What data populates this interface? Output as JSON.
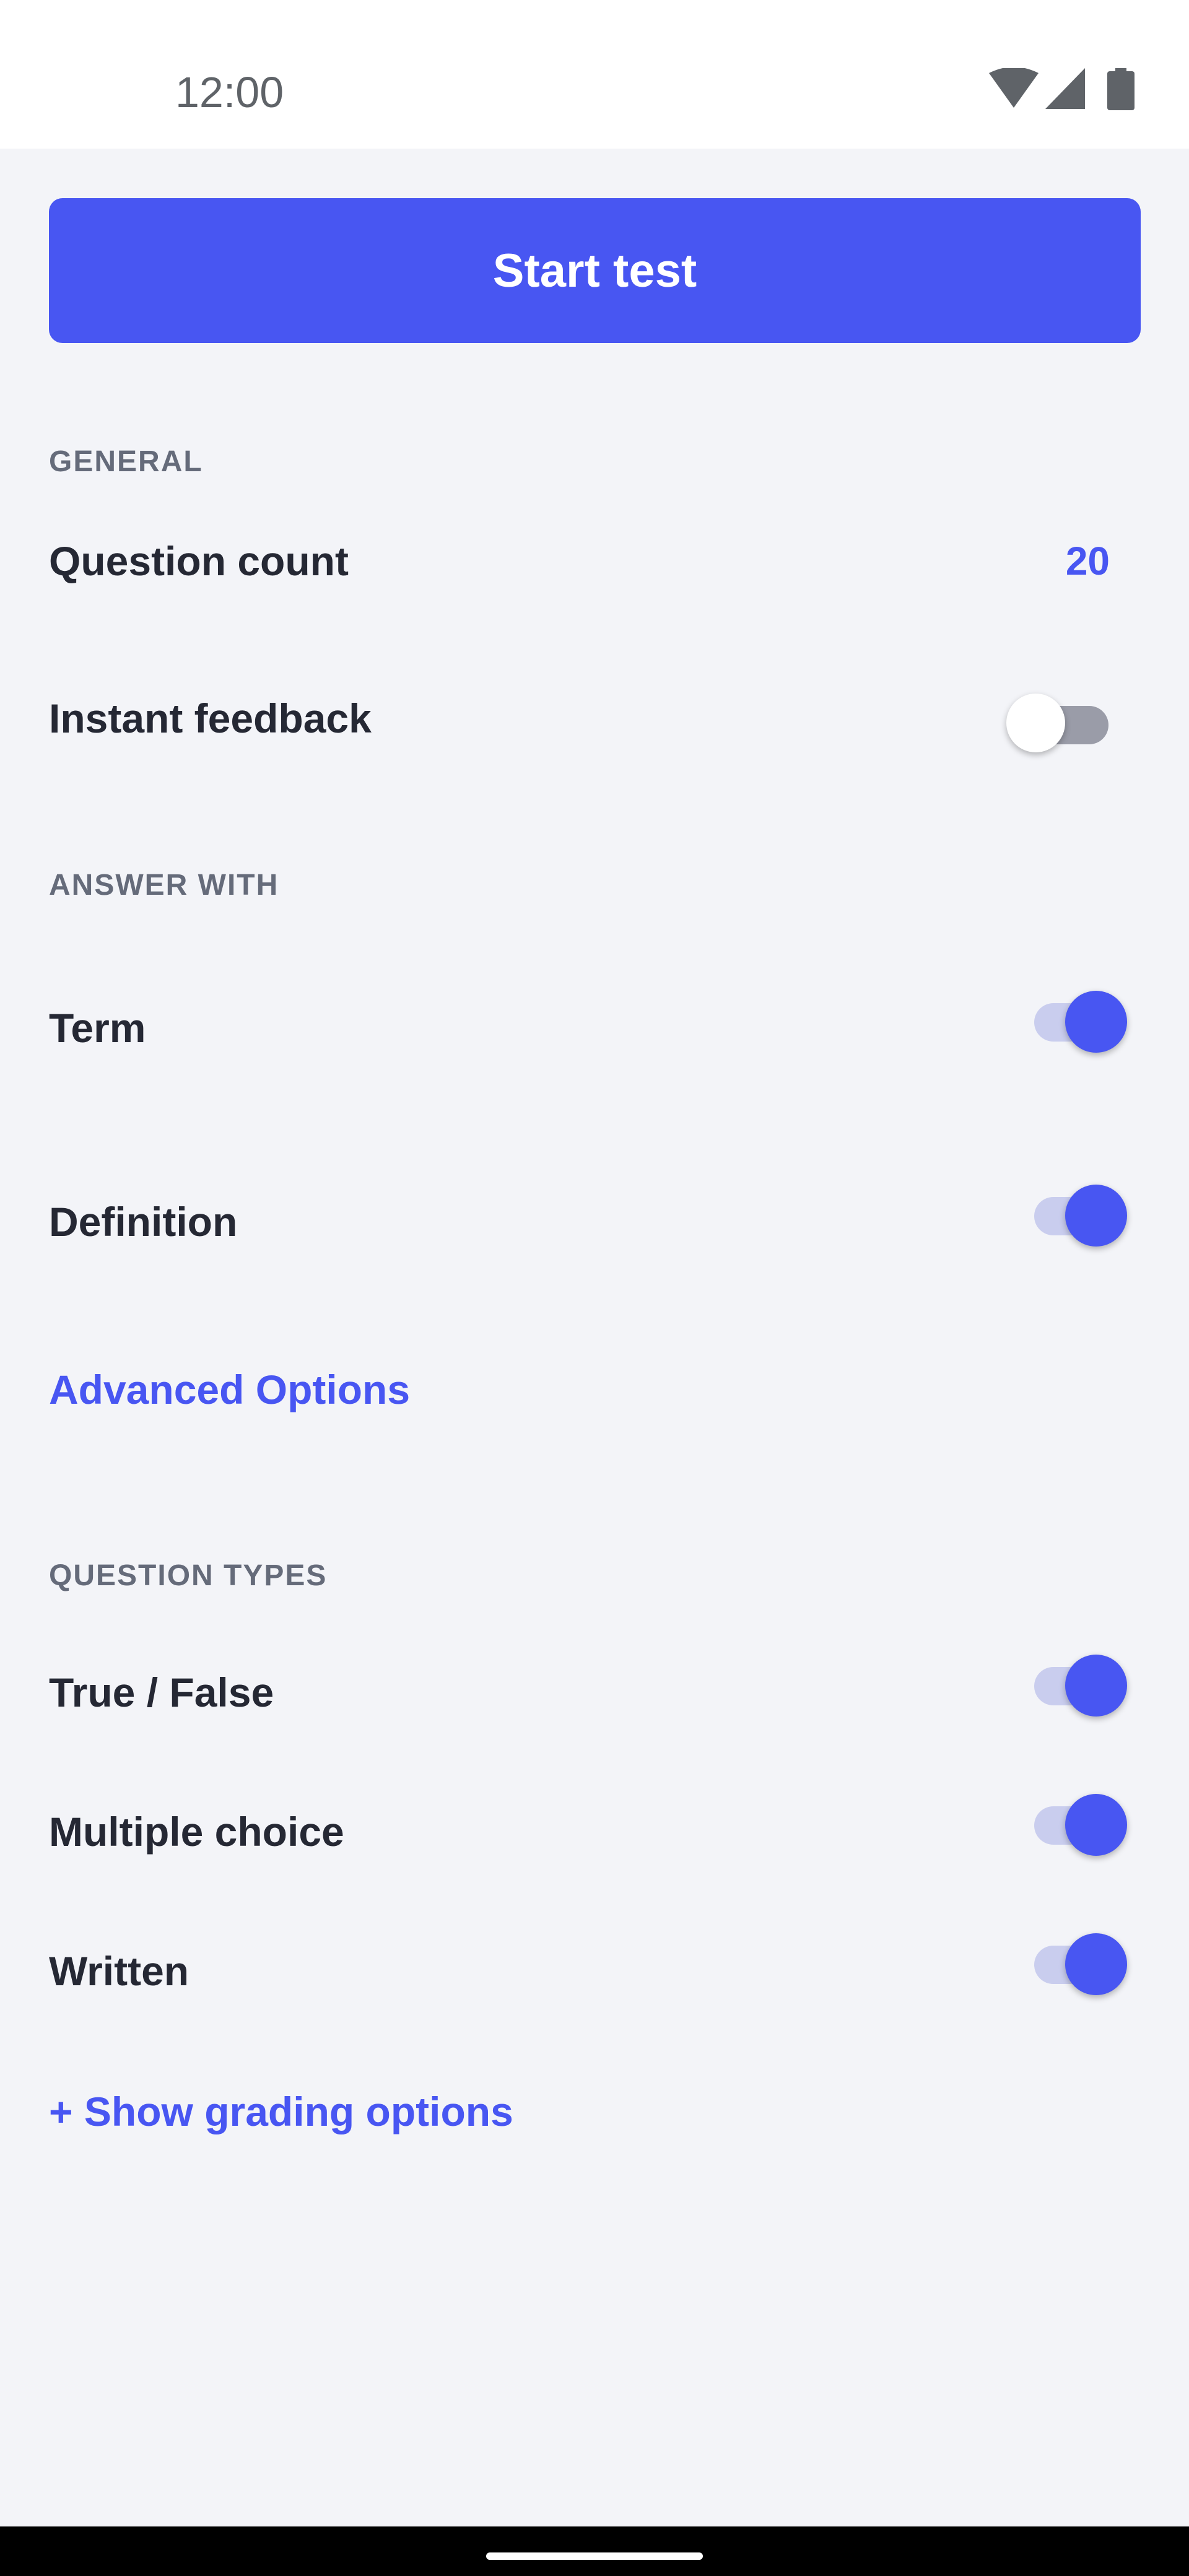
{
  "status_bar": {
    "time": "12:00",
    "icons": [
      "wifi-icon",
      "signal-icon",
      "battery-icon"
    ]
  },
  "start_button": {
    "label": "Start test"
  },
  "general": {
    "header": "GENERAL",
    "question_count": {
      "label": "Question count",
      "value": "20"
    },
    "instant_feedback": {
      "label": "Instant feedback",
      "enabled": false
    }
  },
  "answer_with": {
    "header": "ANSWER WITH",
    "term": {
      "label": "Term",
      "enabled": true
    },
    "definition": {
      "label": "Definition",
      "enabled": true
    }
  },
  "advanced_options": {
    "label": "Advanced Options"
  },
  "question_types": {
    "header": "QUESTION TYPES",
    "true_false": {
      "label": "True / False",
      "enabled": true
    },
    "multiple_choice": {
      "label": "Multiple choice",
      "enabled": true
    },
    "written": {
      "label": "Written",
      "enabled": true
    }
  },
  "grading_link": {
    "label": "+ Show grading options"
  },
  "colors": {
    "accent": "#4856f2",
    "background": "#f3f4f8",
    "text": "#252834",
    "section_label": "#656b7a"
  }
}
